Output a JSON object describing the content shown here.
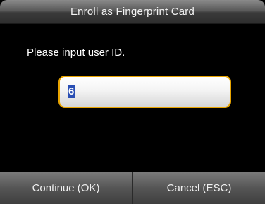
{
  "window": {
    "title": "Enroll as Fingerprint Card"
  },
  "main": {
    "prompt": "Please input user ID.",
    "user_id_input": {
      "value": "6"
    }
  },
  "softkeys": {
    "continue_label": "Continue (OK)",
    "cancel_label": "Cancel (ESC)"
  },
  "colors": {
    "input_border": "#e8a400",
    "selection_highlight": "#2a4fb4"
  }
}
